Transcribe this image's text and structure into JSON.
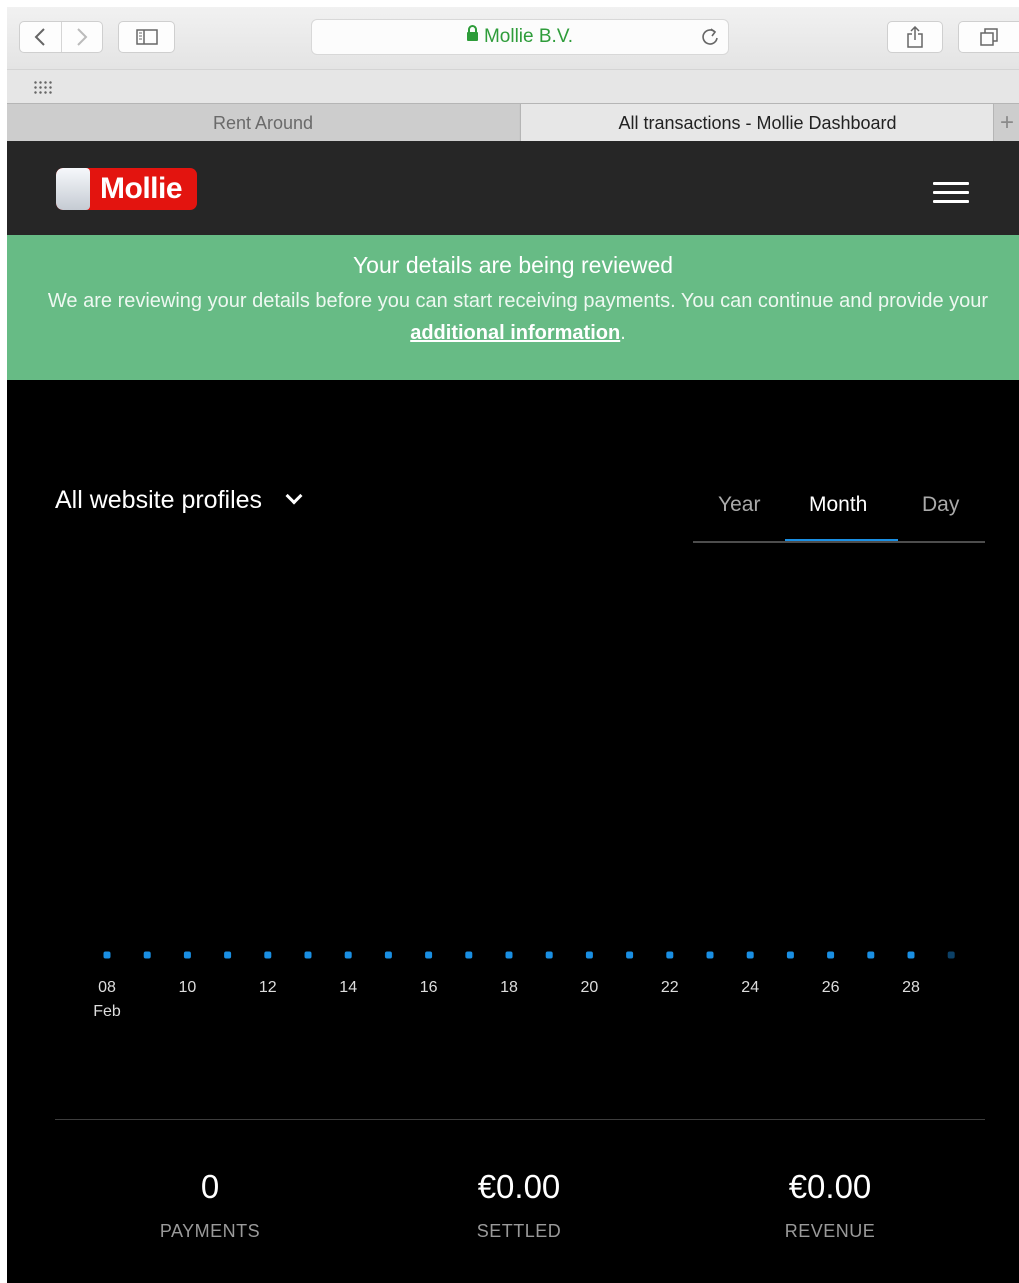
{
  "browser": {
    "address": "Mollie B.V.",
    "tabs": [
      {
        "label": "Rent Around"
      },
      {
        "label": "All transactions - Mollie Dashboard"
      }
    ],
    "new_tab": "+"
  },
  "header": {
    "logo": "Mollie"
  },
  "banner": {
    "title": "Your details are being reviewed",
    "message_before": "We are reviewing your details before you can start receiving payments. You can continue and provide your ",
    "link": "additional information",
    "message_after": "."
  },
  "profile": {
    "label": "All website profiles"
  },
  "periods": {
    "year": "Year",
    "month": "Month",
    "day": "Day",
    "active": "Month"
  },
  "chart_data": {
    "type": "line",
    "x": [
      "08",
      "09",
      "10",
      "11",
      "12",
      "13",
      "14",
      "15",
      "16",
      "17",
      "18",
      "19",
      "20",
      "21",
      "22",
      "23",
      "24",
      "25",
      "26",
      "27",
      "28",
      "29"
    ],
    "values": [
      0,
      0,
      0,
      0,
      0,
      0,
      0,
      0,
      0,
      0,
      0,
      0,
      0,
      0,
      0,
      0,
      0,
      0,
      0,
      0,
      0,
      0
    ],
    "tick_labels": [
      "08",
      "10",
      "12",
      "14",
      "16",
      "18",
      "20",
      "22",
      "24",
      "26",
      "28"
    ],
    "first_tick_sublabel": "Feb",
    "marker_color": "#1a8fe3"
  },
  "stats": [
    {
      "value": "0",
      "label": "PAYMENTS"
    },
    {
      "value": "€0.00",
      "label": "SETTLED"
    },
    {
      "value": "€0.00",
      "label": "REVENUE"
    }
  ]
}
